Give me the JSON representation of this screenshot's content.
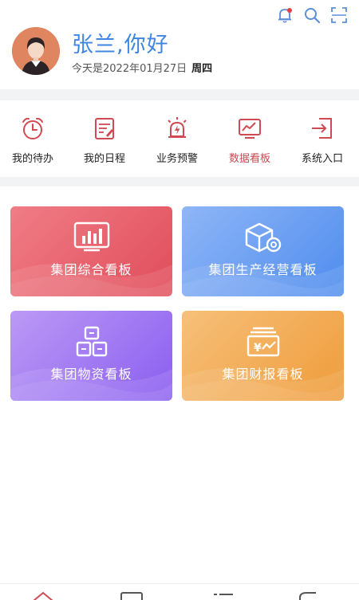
{
  "header": {
    "greeting": "张兰,你好",
    "date_text": "今天是2022年01月27日",
    "weekday": "周四",
    "icons": [
      "bell-icon",
      "search-icon",
      "scan-icon"
    ],
    "notification_dot": true
  },
  "nav": {
    "items": [
      {
        "label": "我的待办",
        "icon": "alarm-clock-icon"
      },
      {
        "label": "我的日程",
        "icon": "calendar-note-icon"
      },
      {
        "label": "业务预警",
        "icon": "siren-icon"
      },
      {
        "label": "数据看板",
        "icon": "monitor-chart-icon",
        "active": true
      },
      {
        "label": "系统入口",
        "icon": "enter-icon"
      }
    ],
    "accent_color": "#c94a52"
  },
  "cards": [
    {
      "label": "集团综合看板",
      "icon": "bar-chart-board-icon",
      "color": "#e45a66"
    },
    {
      "label": "集团生产经营看板",
      "icon": "box-gear-icon",
      "color": "#5a94ef"
    },
    {
      "label": "集团物资看板",
      "icon": "stacked-boxes-icon",
      "color": "#9a70f2"
    },
    {
      "label": "集团财报看板",
      "icon": "yuan-report-icon",
      "color": "#f1a646"
    }
  ],
  "tabbar": {
    "tabs": [
      "home-tab-icon",
      "tab-2-icon",
      "tab-3-icon",
      "tab-4-icon"
    ]
  }
}
